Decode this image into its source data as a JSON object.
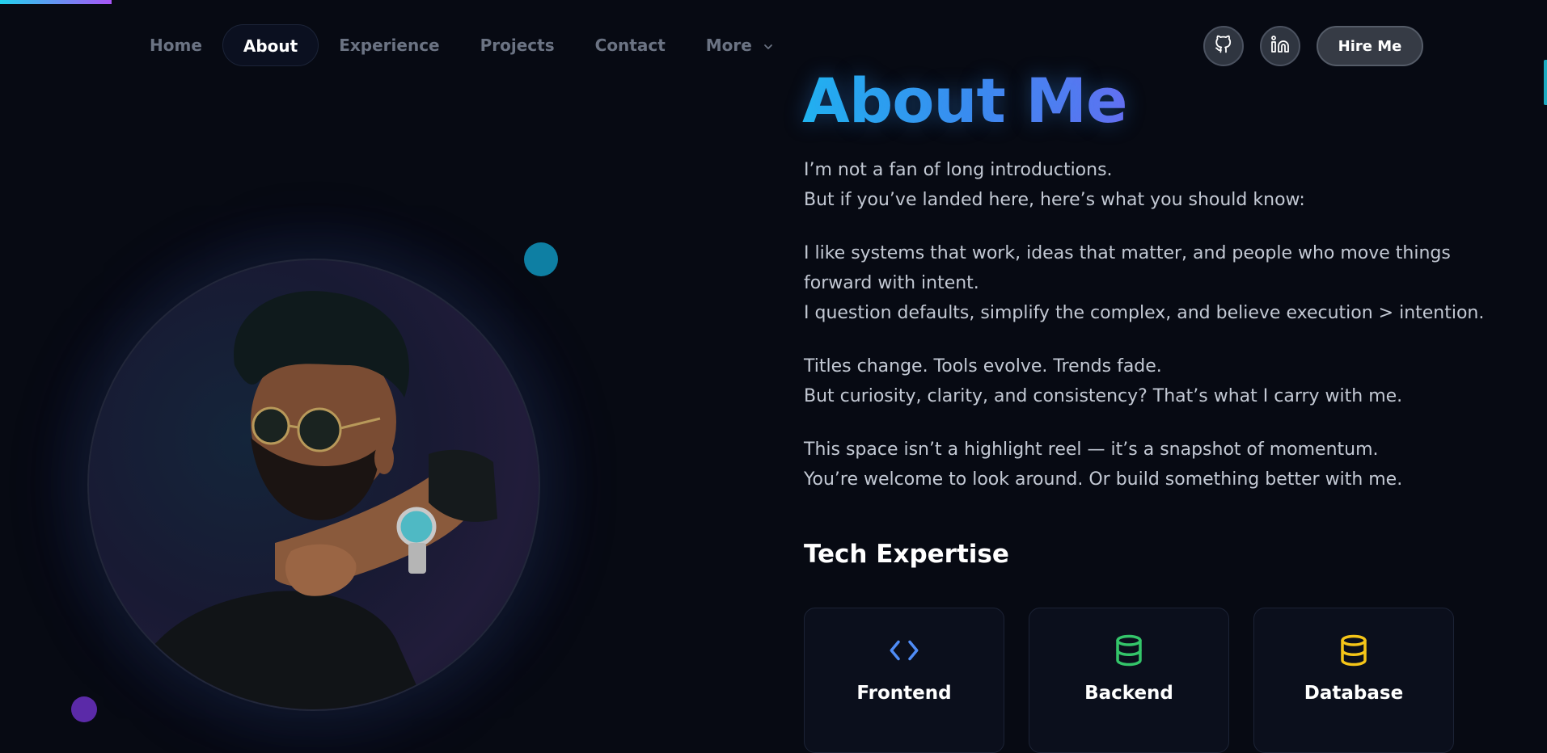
{
  "nav": {
    "items": [
      {
        "label": "Home",
        "active": false
      },
      {
        "label": "About",
        "active": true
      },
      {
        "label": "Experience",
        "active": false
      },
      {
        "label": "Projects",
        "active": false
      },
      {
        "label": "Contact",
        "active": false
      },
      {
        "label": "More",
        "active": false
      }
    ],
    "social": [
      {
        "icon": "github-icon"
      },
      {
        "icon": "linkedin-icon"
      }
    ],
    "cta_label": "Hire Me"
  },
  "about": {
    "title": "About Me",
    "paragraphs": [
      [
        "I’m not a fan of long introductions.",
        "But if you’ve landed here, here’s what you should know:"
      ],
      [
        "I like systems that work, ideas that matter, and people who move things",
        "forward with intent.",
        "I question defaults, simplify the complex, and believe execution > intention."
      ],
      [
        "Titles change. Tools evolve. Trends fade.",
        "But curiosity, clarity, and consistency? That’s what I carry with me."
      ],
      [
        "This space isn’t a highlight reel — it’s a snapshot of momentum.",
        "You’re welcome to look around. Or build something better with me."
      ]
    ]
  },
  "tech": {
    "title": "Tech Expertise",
    "cards": [
      {
        "label": "Frontend",
        "icon": "code-icon",
        "color": "#4f8cf7"
      },
      {
        "label": "Backend",
        "icon": "database-icon",
        "color": "#34c56a"
      },
      {
        "label": "Database",
        "icon": "database-icon",
        "color": "#f5c518"
      }
    ]
  },
  "colors": {
    "background": "#070a13",
    "accent_cyan": "#22d3ee",
    "accent_purple": "#a855f7"
  }
}
